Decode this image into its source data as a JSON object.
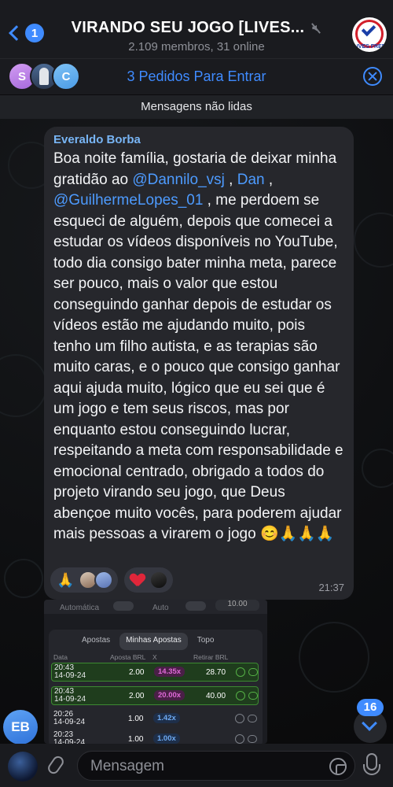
{
  "header": {
    "back_badge": "1",
    "title": "VIRANDO SEU JOGO [LIVES...",
    "subtitle": "2.109 membros, 31 online",
    "group_avatar_text": "LIVES FREE"
  },
  "join_requests": {
    "avatar_letters": [
      "S",
      "C"
    ],
    "label": "3 Pedidos Para Entrar"
  },
  "unread_divider": "Mensagens não lidas",
  "message": {
    "sender": "Everaldo Borba",
    "text_parts": [
      {
        "t": "Boa noite família, gostaria de deixar minha gratidão ao ",
        "m": false
      },
      {
        "t": "@Dannilo_vsj",
        "m": true
      },
      {
        "t": " , ",
        "m": false
      },
      {
        "t": "Dan",
        "m": true
      },
      {
        "t": " , ",
        "m": false
      },
      {
        "t": "@GuilhermeLopes_01",
        "m": true
      },
      {
        "t": " , me perdoem se esqueci de alguém, depois que comecei a estudar os vídeos disponíveis no YouTube, todo dia consigo bater minha meta, parece ser pouco, mais o valor que estou conseguindo ganhar depois de estudar os vídeos estão me ajudando muito, pois tenho um filho autista, e as terapias são muito caras, e o pouco que consigo ganhar aqui ajuda muito, lógico que eu sei que é um jogo e tem seus riscos, mas por enquanto estou conseguindo lucrar, respeitando a meta com responsabilidade e emocional centrado, obrigado a todos do projeto virando seu jogo, que Deus abençoe muito vocês, para poderem ajudar mais pessoas a virarem o jogo 😊🙏🙏🙏",
        "m": false
      }
    ],
    "reactions": [
      {
        "emoji": "🙏",
        "icon": "pray-emoji"
      },
      {
        "emoji": "",
        "icon": "heart-icon"
      }
    ],
    "time": "21:37"
  },
  "screenshot": {
    "auto_left": "Automática",
    "auto_right": "Auto",
    "amount_pill": "10.00",
    "tabs": [
      "Apostas",
      "Minhas Apostas",
      "Topo"
    ],
    "active_tab": 1,
    "columns": [
      "Data",
      "Aposta BRL",
      "X",
      "Retirar BRL"
    ],
    "rows": [
      {
        "time": "20:43",
        "date": "14-09-24",
        "bet": "2.00",
        "mult": "14.35x",
        "cashout": "28.70",
        "win": true,
        "mult_color": "pink"
      },
      {
        "time": "20:43",
        "date": "14-09-24",
        "bet": "2.00",
        "mult": "20.00x",
        "cashout": "40.00",
        "win": true,
        "mult_color": "pink"
      },
      {
        "time": "20:26",
        "date": "14-09-24",
        "bet": "1.00",
        "mult": "1.42x",
        "cashout": "",
        "win": false,
        "mult_color": "blue"
      },
      {
        "time": "20:23",
        "date": "14-09-24",
        "bet": "1.00",
        "mult": "1.00x",
        "cashout": "",
        "win": false,
        "mult_color": "blue"
      }
    ]
  },
  "floating": {
    "sender_avatar": "EB",
    "unread_count": "16"
  },
  "input": {
    "placeholder": "Mensagem"
  },
  "colors": {
    "accent": "#3f8bff",
    "bubble": "#26272c",
    "mention": "#4d9bff",
    "sender": "#78b5f5"
  }
}
